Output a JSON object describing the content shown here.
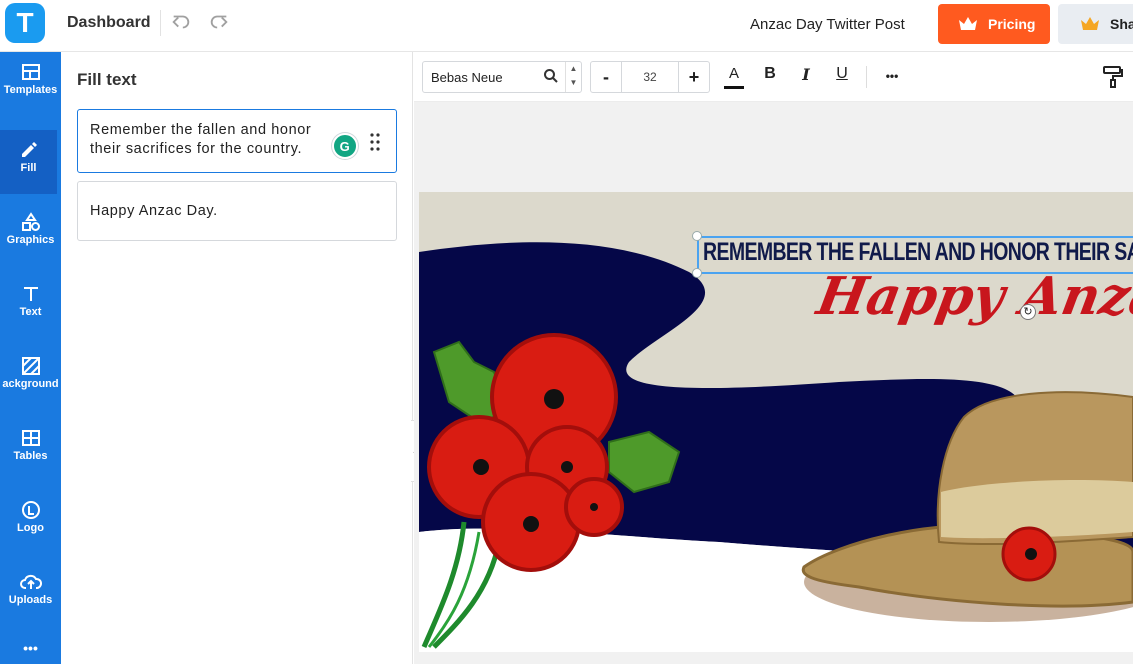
{
  "app": {
    "logo_letter": "T",
    "nav_title": "Dashboard",
    "doc_title": "Anzac Day Twitter Post",
    "pricing_label": "Pricing",
    "share_label": "Sha",
    "brand_color": "#1a7ae0",
    "pricing_color": "#ff5a1f"
  },
  "sidebar": {
    "items": [
      {
        "label": "Templates",
        "icon": "templates-icon"
      },
      {
        "label": "Fill",
        "icon": "pencil-icon",
        "active": true
      },
      {
        "label": "Graphics",
        "icon": "shapes-icon"
      },
      {
        "label": "Text",
        "icon": "text-icon"
      },
      {
        "label": "ackground",
        "icon": "background-icon"
      },
      {
        "label": "Tables",
        "icon": "table-icon"
      },
      {
        "label": "Logo",
        "icon": "logo-icon"
      },
      {
        "label": "Uploads",
        "icon": "upload-cloud-icon"
      }
    ],
    "more": "•••"
  },
  "fill_panel": {
    "title": "Fill text",
    "fields": [
      {
        "value": "Remember the fallen and honor their sacrifices for the country."
      },
      {
        "value": "Happy Anzac Day."
      }
    ],
    "grammarly_letter": "G"
  },
  "toolbar": {
    "font": "Bebas Neue",
    "font_size": "32",
    "minus": "-",
    "plus": "+",
    "color_btn": "A",
    "bold": "B",
    "italic": "I",
    "underline": "U",
    "more": "•••"
  },
  "canvas": {
    "headline": "REMEMBER THE FALLEN AND HONOR THEIR SACRIFI",
    "script": "Happy Anzac D",
    "background_color": "#dcd9cc",
    "navy_color": "#050748",
    "poppy_color": "#d91c12"
  }
}
